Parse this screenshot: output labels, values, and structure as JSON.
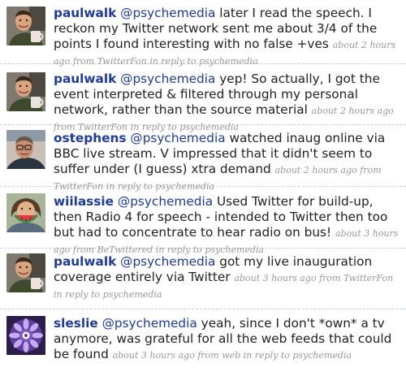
{
  "tweets": [
    {
      "author": "paulwalk",
      "mention": "@psychemedia",
      "text": "later I read the speech. I reckon my Twitter network sent me about 3/4 of the points I found interesting with no false +ves",
      "meta": "about 2 hours ago from TwitterFon in reply to psychemedia",
      "avatar_icon": "man-with-mug-avatar"
    },
    {
      "author": "paulwalk",
      "mention": "@psychemedia",
      "text": "yep! So actually, I got the event interpreted & filtered through my personal network, rather than the source material",
      "meta": "about 2 hours ago from TwitterFon in reply to psychemedia",
      "avatar_icon": "man-with-mug-avatar"
    },
    {
      "author": "ostephens",
      "mention": "@psychemedia",
      "text": "watched inaug online via BBC live stream. V impressed that it didn't seem to suffer under (I guess) xtra demand",
      "meta": "about 2 hours ago from TwitterFon in reply to psychemedia",
      "avatar_icon": "man-with-glasses-avatar"
    },
    {
      "author": "wiilassie",
      "mention": "@psychemedia",
      "text": "Used Twitter for build-up, then Radio 4 for speech - intended to Twitter then too but had to concentrate to hear radio on bus!",
      "meta": "about 3 hours ago from BeTwittered in reply to psychemedia",
      "avatar_icon": "woman-with-watermelon-avatar"
    },
    {
      "author": "paulwalk",
      "mention": "@psychemedia",
      "text": "got my live inauguration coverage entirely via Twitter",
      "meta": "about 3 hours ago from TwitterFon in reply to psychemedia",
      "avatar_icon": "man-with-mug-avatar"
    },
    {
      "author": "sleslie",
      "mention": "@psychemedia",
      "text": "yeah, since I don't *own* a tv anymore, was grateful for all the web feeds that could be found",
      "meta": "about 3 hours ago from web in reply to psychemedia",
      "avatar_icon": "purple-mandala-avatar"
    }
  ]
}
